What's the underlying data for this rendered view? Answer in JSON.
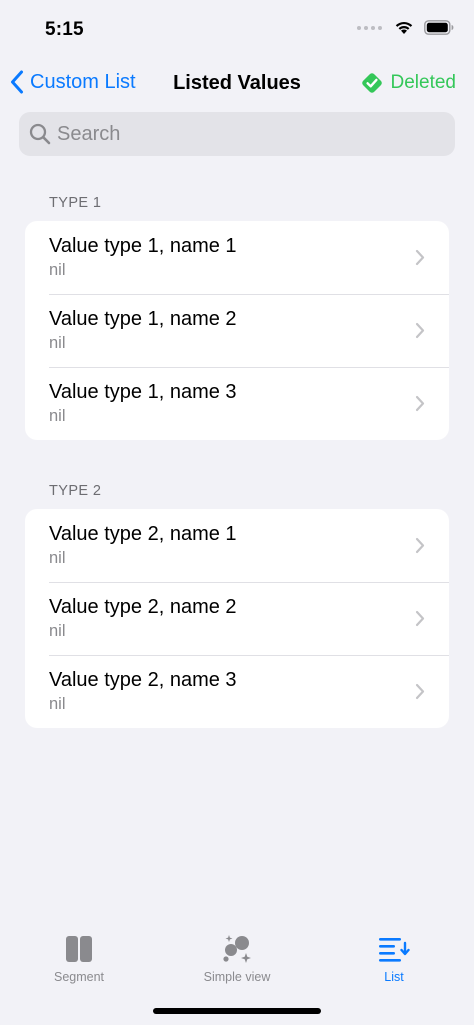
{
  "status_bar": {
    "time": "5:15"
  },
  "nav": {
    "back_label": "Custom List",
    "title": "Listed Values",
    "status_label": "Deleted",
    "status_color": "#34C759",
    "accent_color": "#0A7AFF"
  },
  "search": {
    "placeholder": "Search",
    "value": ""
  },
  "sections": [
    {
      "header": "TYPE 1",
      "rows": [
        {
          "title": "Value type 1, name 1",
          "subtitle": "nil"
        },
        {
          "title": "Value type 1, name 2",
          "subtitle": "nil"
        },
        {
          "title": "Value type 1, name 3",
          "subtitle": "nil"
        }
      ]
    },
    {
      "header": "TYPE 2",
      "rows": [
        {
          "title": "Value type 2, name 1",
          "subtitle": "nil"
        },
        {
          "title": "Value type 2, name 2",
          "subtitle": "nil"
        },
        {
          "title": "Value type 2, name 3",
          "subtitle": "nil"
        }
      ]
    }
  ],
  "tab_bar": {
    "tabs": [
      {
        "label": "Segment",
        "icon": "segment-icon",
        "active": false
      },
      {
        "label": "Simple view",
        "icon": "simple-view-icon",
        "active": false
      },
      {
        "label": "List",
        "icon": "list-icon",
        "active": true
      }
    ]
  }
}
